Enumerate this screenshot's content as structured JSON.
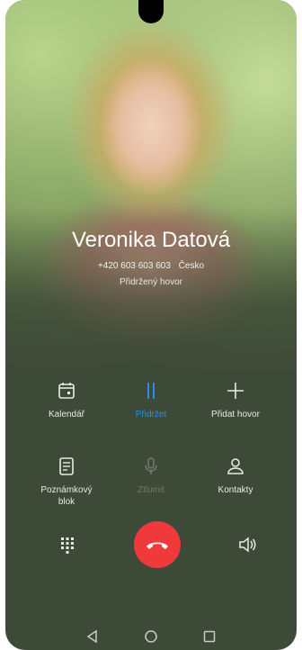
{
  "call": {
    "contact_name": "Veronika Datová",
    "phone_number": "+420 603 603 603",
    "location": "Česko",
    "status": "Přidržený hovor"
  },
  "actions": {
    "calendar": {
      "label": "Kalendář",
      "icon": "calendar-icon"
    },
    "hold": {
      "label": "Přidržet",
      "icon": "pause-icon",
      "active": true
    },
    "add_call": {
      "label": "Přidat hovor",
      "icon": "plus-icon"
    },
    "notepad": {
      "label": "Poznámkový blok",
      "label_line1": "Poznámkový",
      "label_line2": "blok",
      "icon": "notepad-icon"
    },
    "mute": {
      "label": "Ztlumit",
      "icon": "microphone-icon",
      "disabled": true
    },
    "contacts": {
      "label": "Kontakty",
      "icon": "person-icon"
    }
  },
  "controls": {
    "dialpad_icon": "dialpad-icon",
    "end_call_icon": "end-call-icon",
    "speaker_icon": "speaker-icon"
  },
  "navigation": {
    "back_icon": "back-triangle-icon",
    "home_icon": "home-circle-icon",
    "recents_icon": "recents-square-icon"
  },
  "colors": {
    "background": "#3e4a38",
    "active_accent": "#2a8de0",
    "end_call": "#f0393b",
    "text": "#ffffff"
  }
}
